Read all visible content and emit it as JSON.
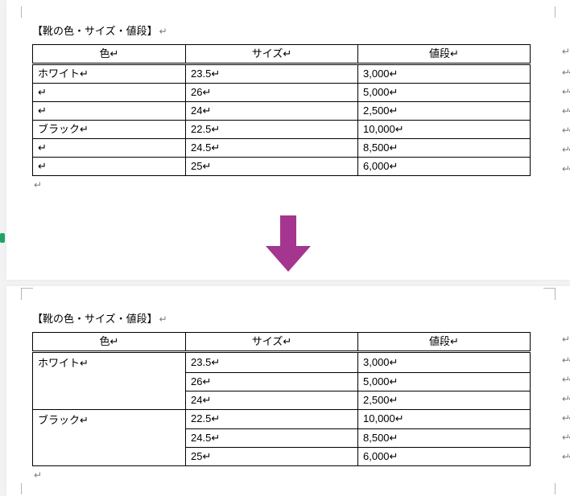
{
  "title": "【靴の色・サイズ・値段】",
  "pmark": "↵",
  "headers": {
    "color": "色",
    "size": "サイズ",
    "price": "値段"
  },
  "rows": [
    {
      "color": "ホワイト",
      "size": "23.5",
      "price": "3,000"
    },
    {
      "color": "",
      "size": "26",
      "price": "5,000"
    },
    {
      "color": "",
      "size": "24",
      "price": "2,500"
    },
    {
      "color": "ブラック",
      "size": "22.5",
      "price": "10,000"
    },
    {
      "color": "",
      "size": "24.5",
      "price": "8,500"
    },
    {
      "color": "",
      "size": "25",
      "price": "6,000"
    }
  ],
  "merged_groups": [
    {
      "color": "ホワイト",
      "span": 3
    },
    {
      "color": "ブラック",
      "span": 3
    }
  ],
  "arrow_color": "#a4368f",
  "chart_data": {
    "type": "table",
    "title": "靴の色・サイズ・値段",
    "columns": [
      "色",
      "サイズ",
      "値段"
    ],
    "rows": [
      [
        "ホワイト",
        23.5,
        3000
      ],
      [
        "ホワイト",
        26,
        5000
      ],
      [
        "ホワイト",
        24,
        2500
      ],
      [
        "ブラック",
        22.5,
        10000
      ],
      [
        "ブラック",
        24.5,
        8500
      ],
      [
        "ブラック",
        25,
        6000
      ]
    ]
  }
}
